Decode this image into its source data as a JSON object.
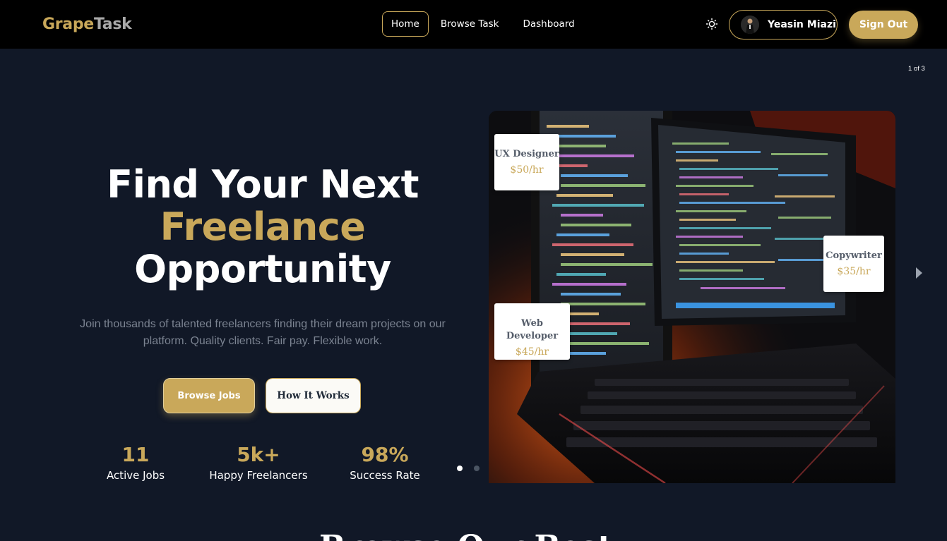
{
  "nav": {
    "logo_part1": "Grape",
    "logo_part2": "Task",
    "links": [
      {
        "label": "Home",
        "active": true
      },
      {
        "label": "Browse Task",
        "active": false
      },
      {
        "label": "Dashboard",
        "active": false
      }
    ],
    "theme_icon": "sun-icon",
    "user_name": "Yeasin Miazi",
    "sign_out_label": "Sign Out"
  },
  "slider": {
    "counter": "1 of 3",
    "current": 1,
    "total": 3
  },
  "hero": {
    "line1": "Find Your Next",
    "line2": "Freelance",
    "line3": "Opportunity",
    "subtitle": "Join thousands of talented freelancers finding their dream projects on our platform. Quality clients. Fair pay. Flexible work.",
    "primary_button": "Browse Jobs",
    "secondary_button": "How It Works"
  },
  "stats": [
    {
      "value": "11",
      "label": "Active Jobs"
    },
    {
      "value": "5k+",
      "label": "Happy Freelancers"
    },
    {
      "value": "98%",
      "label": "Success Rate"
    }
  ],
  "tags": [
    {
      "title": "UX Designer",
      "price": "$50/hr"
    },
    {
      "title": "Copywriter",
      "price": "$35/hr"
    },
    {
      "title": "Web Developer",
      "price": "$45/hr"
    }
  ],
  "next_section_heading": "Browse Our Best",
  "colors": {
    "accent": "#c9a85a",
    "background": "#111827",
    "navbar": "#000000"
  }
}
